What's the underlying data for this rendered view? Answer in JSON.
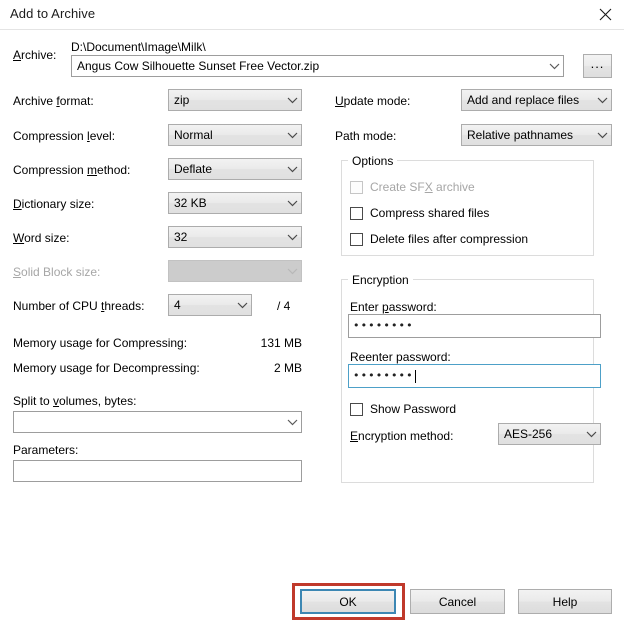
{
  "window": {
    "title": "Add to Archive",
    "close_icon": "close-icon"
  },
  "archive": {
    "label": "A",
    "label_rest": "rchive:",
    "path": "D:\\Document\\Image\\Milk\\",
    "filename": "Angus Cow Silhouette Sunset Free Vector.zip",
    "browse_label": "..."
  },
  "left_fields": [
    {
      "label_pre": "Archive ",
      "label_mn": "f",
      "label_post": "ormat:",
      "value": "zip",
      "disabled": false
    },
    {
      "label_pre": "Compression ",
      "label_mn": "l",
      "label_post": "evel:",
      "value": "Normal",
      "disabled": false
    },
    {
      "label_pre": "Compression ",
      "label_mn": "m",
      "label_post": "ethod:",
      "value": "Deflate",
      "disabled": false
    },
    {
      "label_pre": "",
      "label_mn": "D",
      "label_post": "ictionary size:",
      "value": "32 KB",
      "disabled": false
    },
    {
      "label_pre": "",
      "label_mn": "W",
      "label_post": "ord size:",
      "value": "32",
      "disabled": false
    },
    {
      "label_pre": "",
      "label_mn": "S",
      "label_post": "olid Block size:",
      "value": "",
      "disabled": true
    }
  ],
  "cpu": {
    "label_pre": "Number of CPU ",
    "label_mn": "t",
    "label_post": "hreads:",
    "value": "4",
    "max_label": "/ 4"
  },
  "memory": [
    {
      "label": "Memory usage for Compressing:",
      "value": "131 MB"
    },
    {
      "label": "Memory usage for Decompressing:",
      "value": "2 MB"
    }
  ],
  "split": {
    "label_pre": "Split to ",
    "label_mn": "v",
    "label_post": "olumes, bytes:",
    "value": ""
  },
  "parameters": {
    "label": "Parameters:",
    "value": ""
  },
  "right_fields": [
    {
      "label_pre": "",
      "label_mn": "U",
      "label_post": "pdate mode:",
      "value": "Add and replace files"
    },
    {
      "label_pre": "Path mode:",
      "label_mn": "",
      "label_post": "",
      "value": "Relative pathnames"
    }
  ],
  "options": {
    "title": "Options",
    "items": [
      {
        "label_pre": "Create SF",
        "label_mn": "X",
        "label_post": " archive",
        "checked": false,
        "disabled": true
      },
      {
        "label_pre": "Compress shared files",
        "label_mn": "",
        "label_post": "",
        "checked": false,
        "disabled": false
      },
      {
        "label_pre": "Delete files after compression",
        "label_mn": "",
        "label_post": "",
        "checked": false,
        "disabled": false
      }
    ]
  },
  "encryption": {
    "title": "Encryption",
    "enter_label_pre": "Enter ",
    "enter_label_mn": "p",
    "enter_label_post": "assword:",
    "enter_value": "••••••••",
    "reenter_label": "Reenter password:",
    "reenter_value": "••••••••",
    "show_password_label": "Show Password",
    "show_password_checked": false,
    "method_label_pre": "",
    "method_label_mn": "E",
    "method_label_post": "ncryption method:",
    "method_value": "AES-256"
  },
  "buttons": {
    "ok": "OK",
    "cancel": "Cancel",
    "help": "Help"
  },
  "colors": {
    "highlight_red": "#c0392b",
    "focus_blue": "#3c87b3",
    "field_focus_blue": "#4da0c8"
  }
}
